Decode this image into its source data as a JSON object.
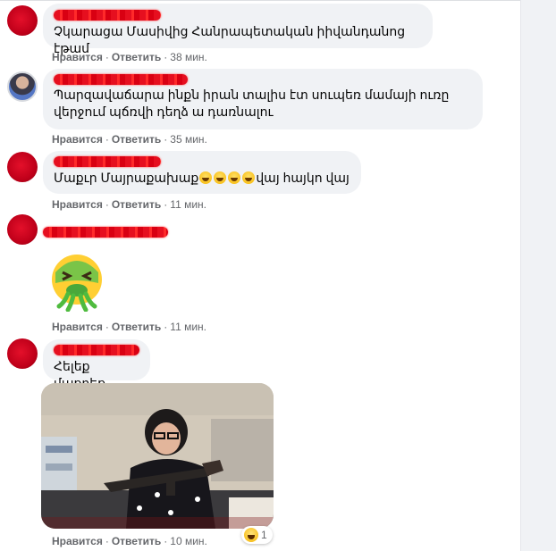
{
  "comments": [
    {
      "text": "Չկարացա Մասիվից Հանրապետական իիվանդանոց էթամ",
      "like": "Нравится",
      "reply": "Ответить",
      "time": "38 мин."
    },
    {
      "text": "Պարզավաճարա ինքն իրան տալիս էտ սուպեռ մամայի ուռը\nվերջում պճռվի դեղձ ա դառնալու",
      "like": "Нравится",
      "reply": "Ответить",
      "time": "35 мин."
    },
    {
      "text_before": "Մաքւր Մայրաքախաք",
      "text_after": "վայ հայկո վայ",
      "emoji_count": 4,
      "emoji": "grinning-face",
      "like": "Нравится",
      "reply": "Ответить",
      "time": "11 мин."
    },
    {
      "sticker": "vomiting-face-sticker",
      "like": "Нравится",
      "reply": "Ответить",
      "time": "11 мин."
    },
    {
      "text": "Հելեք մաքրեք",
      "gif": "woman-with-rifle-in-store-gif",
      "like": "Нравится",
      "reply": "Ответить",
      "time": "10 мин.",
      "reaction": {
        "icon": "haha-reaction-icon",
        "count": "1"
      }
    }
  ],
  "colors": {
    "bubble": "#f0f2f5",
    "meta_text": "#65676b",
    "name_redaction": "#e60f1f"
  }
}
